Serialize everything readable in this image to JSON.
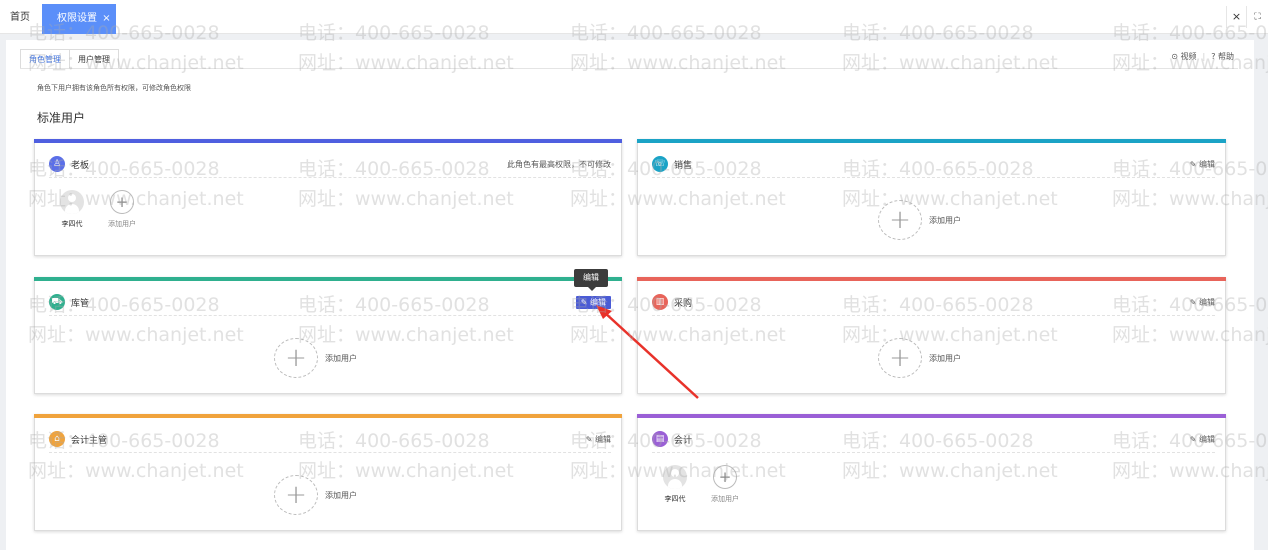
{
  "topbar": {
    "home_label": "首页",
    "active_tab_label": "权限设置",
    "active_tab_close": "×",
    "close_icon": "×",
    "fullscreen_icon": "⛶"
  },
  "subtabs": {
    "role_mgmt": "角色管理",
    "user_mgmt": "用户管理"
  },
  "help": {
    "video": "视频",
    "help": "帮助",
    "video_icon": "⊙",
    "help_icon": "?"
  },
  "hint": "角色下用户拥有该角色所有权限，可修改角色权限",
  "section_title": "标准用户",
  "tooltip": "编辑",
  "cards": [
    {
      "name": "老板",
      "color": "#4f5fe0",
      "icon_color": "#5b6fe8",
      "right_note": "此角色有最高权限，不可修改",
      "users": [
        {
          "name": "李四代"
        }
      ],
      "add_label": "添加用户"
    },
    {
      "name": "销售",
      "color": "#1ba3c6",
      "icon_color": "#1ba3c6",
      "edit": "编辑",
      "add_label": "添加用户"
    },
    {
      "name": "库管",
      "color": "#2fb08f",
      "icon_color": "#2fb08f",
      "edit": "编辑",
      "add_label": "添加用户"
    },
    {
      "name": "采购",
      "color": "#e8645a",
      "icon_color": "#e8645a",
      "edit": "编辑",
      "add_label": "添加用户"
    },
    {
      "name": "会计主管",
      "color": "#f0a33c",
      "icon_color": "#f0a33c",
      "edit": "编辑",
      "add_label": "添加用户"
    },
    {
      "name": "会计",
      "color": "#9a5fd6",
      "icon_color": "#9a5fd6",
      "edit": "编辑",
      "users": [
        {
          "name": "李四代"
        }
      ],
      "add_label": "添加用户"
    }
  ],
  "watermark": {
    "phone": "电话：400-665-0028",
    "site": "网址：www.chanjet.net"
  }
}
